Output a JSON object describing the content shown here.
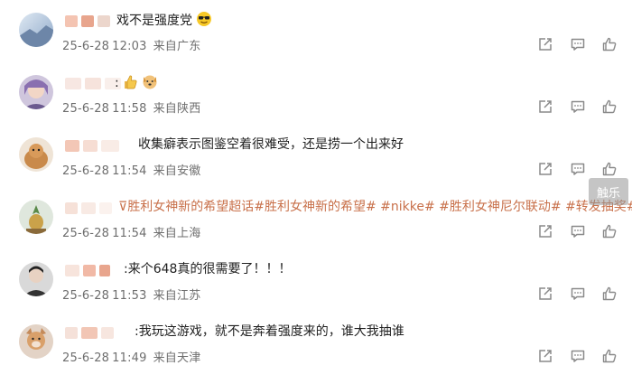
{
  "comments": [
    {
      "text": "戏不是强度党",
      "date": "25-6-28",
      "time": "12:03",
      "location": "来自广东",
      "emoji": "sunglasses-emoji"
    },
    {
      "text": ":",
      "date": "25-6-28",
      "time": "11:58",
      "location": "来自陕西",
      "emoji": "thumbs-up-emoji, dog-emoji"
    },
    {
      "text": "收集癖表示图鉴空着很难受，还是捞一个出来好",
      "date": "25-6-28",
      "time": "11:54",
      "location": "来自安徽"
    },
    {
      "text": "胜利女神新的希望超话#胜利女神新的希望# #nikke# #胜利女神尼尔联动# #转发抽奖#",
      "date": "25-6-28",
      "time": "11:54",
      "location": "来自上海"
    },
    {
      "text": ":来个648真的很需要了！！！",
      "date": "25-6-28",
      "time": "11:53",
      "location": "来自江苏"
    },
    {
      "text": ":我玩这游戏，就不是奔着强度来的，谁大我抽谁",
      "date": "25-6-28",
      "time": "11:49",
      "location": "来自天津"
    }
  ],
  "watermark": "触乐",
  "icons": {
    "share": "share-icon",
    "comment": "comment-icon",
    "like": "like-icon"
  },
  "colors": {
    "topic": "#c8704a",
    "meta": "#6e6e6e",
    "icon": "#8a8a8a"
  }
}
